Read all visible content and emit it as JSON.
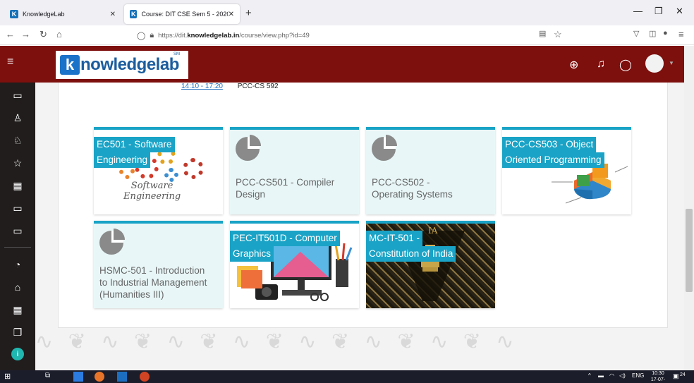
{
  "browser": {
    "tabs": [
      {
        "label": "KnowledgeLab",
        "active": false
      },
      {
        "label": "Course: DIT CSE Sem 5 - 2020 - ...",
        "active": true
      }
    ],
    "url_prefix": "https://dit.",
    "url_domain": "knowledgelab.in",
    "url_path": "/course/view.php?id=49"
  },
  "header": {
    "logo_letter": "k",
    "logo_text": "nowledgelab",
    "logo_tm": "SM",
    "brand_color": "#7d0f0d"
  },
  "schedule_row": {
    "time": "14:10 - 17:20",
    "code": "PCC-CS 592"
  },
  "courses": [
    {
      "title_lines": [
        "EC501 - Software",
        "Engineering"
      ],
      "image": "software-engineering",
      "image_text": [
        "Software",
        "Engineering"
      ]
    },
    {
      "title_lines": [
        "PCC-CS501 - Compiler",
        "Design"
      ],
      "image": "none"
    },
    {
      "title_lines": [
        "PCC-CS502 -",
        "Operating Systems"
      ],
      "image": "none"
    },
    {
      "title_lines": [
        "PCC-CS503 - Object",
        "Oriented Programming"
      ],
      "image": "oop-chart"
    },
    {
      "title_lines": [
        "HSMC-501 - Introduction",
        "to Industrial Management",
        "(Humanities III)"
      ],
      "image": "none"
    },
    {
      "title_lines": [
        "PEC-IT501D - Computer",
        "Graphics"
      ],
      "image": "computer-graphics"
    },
    {
      "title_lines": [
        "MC-IT-501 -",
        "Constitution of India"
      ],
      "image": "constitution"
    }
  ],
  "taskbar": {
    "time": "10:30",
    "date": "17-07-2021",
    "lang": "ENG",
    "notif_count": "24"
  },
  "colors": {
    "accent": "#1aa3c6",
    "card_bg": "#e8f6f7",
    "sidebar": "#211d1d"
  }
}
